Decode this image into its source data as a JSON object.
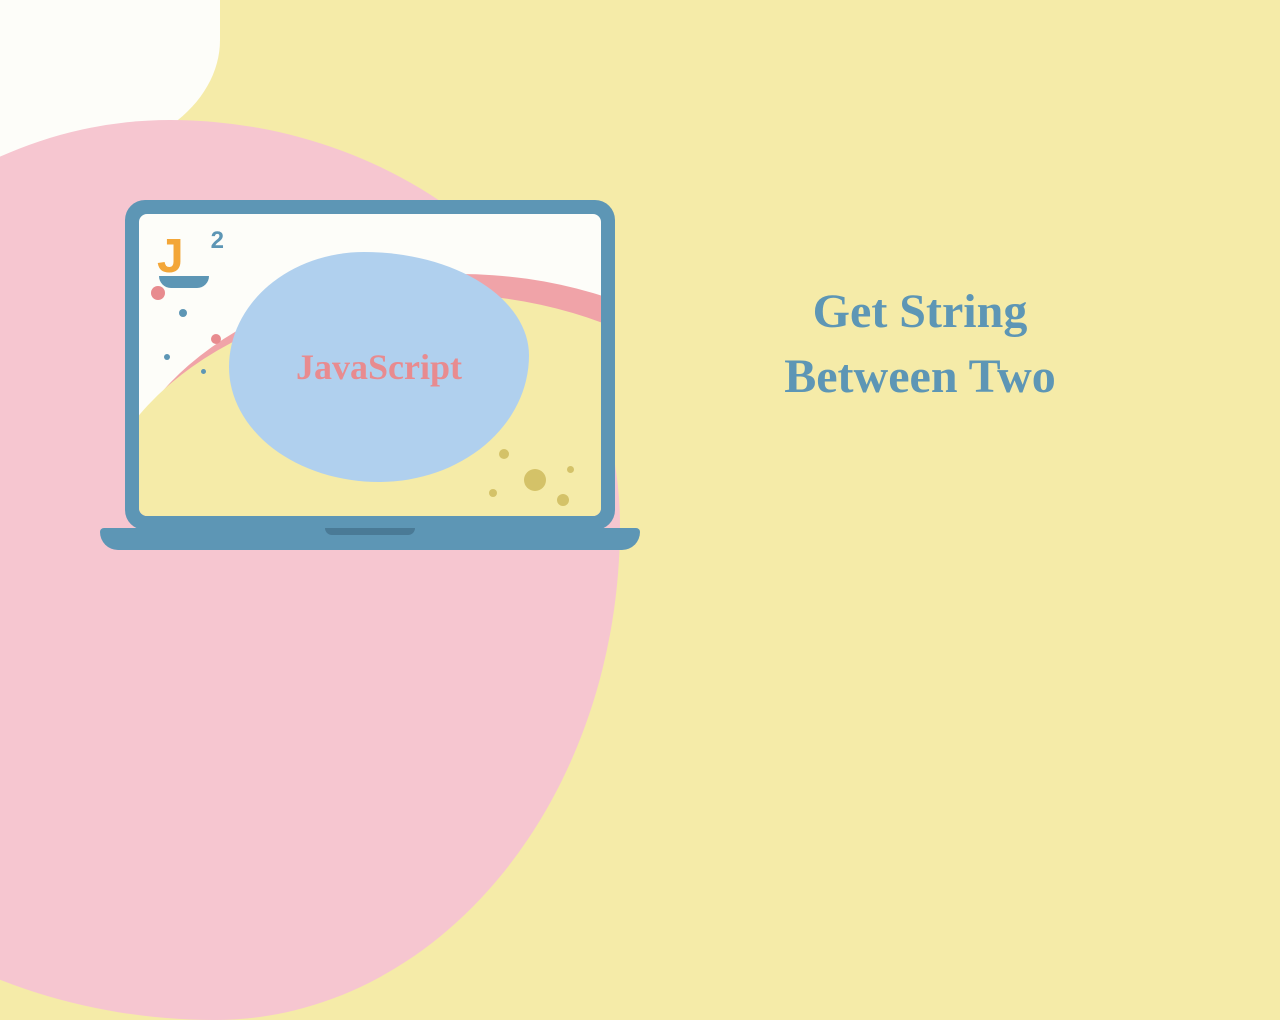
{
  "logo": {
    "letter": "J",
    "superscript": "2"
  },
  "laptop": {
    "blob_label": "JavaScript"
  },
  "headline": {
    "line1": "Get String",
    "line2": "Between Two"
  },
  "colors": {
    "background": "#f5eba8",
    "pink": "#f6c6d0",
    "blue": "#5d96b5",
    "lightblue": "#b0d0ee",
    "salmon": "#e88b8f",
    "orange": "#f3a638"
  }
}
